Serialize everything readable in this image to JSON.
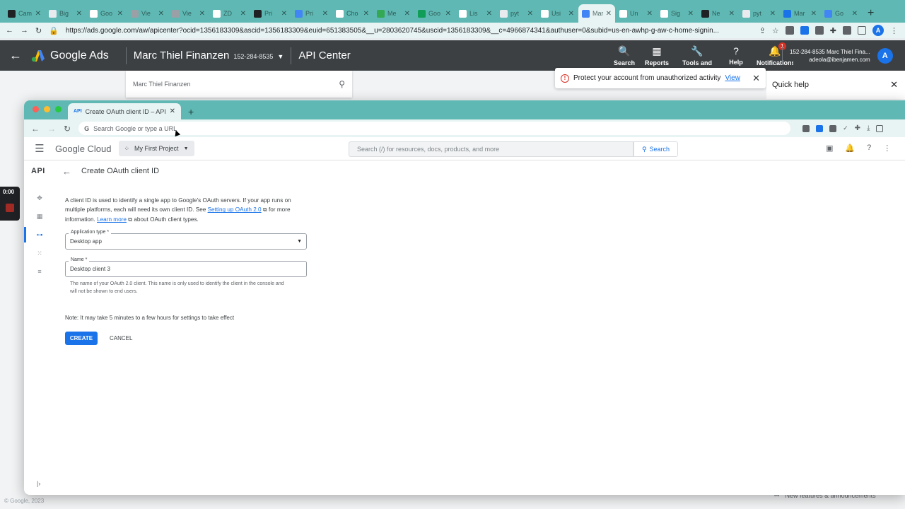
{
  "outer_tabs": [
    {
      "title": "Cam",
      "color": "#202124"
    },
    {
      "title": "Big",
      "color": "#e8eaed"
    },
    {
      "title": "Goo",
      "color": "#ffffff"
    },
    {
      "title": "Vie",
      "color": "#9aa0a6"
    },
    {
      "title": "Vie",
      "color": "#9aa0a6"
    },
    {
      "title": "ZD",
      "color": "#ffffff"
    },
    {
      "title": "Pri",
      "color": "#202124"
    },
    {
      "title": "Pri",
      "color": "#4285f4"
    },
    {
      "title": "Cho",
      "color": "#ffffff"
    },
    {
      "title": "Me",
      "color": "#34a853"
    },
    {
      "title": "Goo",
      "color": "#0f9d58"
    },
    {
      "title": "Lis",
      "color": "#ffffff"
    },
    {
      "title": "pyt",
      "color": "#e8eaed"
    },
    {
      "title": "Usi",
      "color": "#ffffff"
    },
    {
      "title": "Mar",
      "color": "#4285f4"
    },
    {
      "title": "Un",
      "color": "#ffffff"
    },
    {
      "title": "Sig",
      "color": "#ffffff"
    },
    {
      "title": "Ne",
      "color": "#202124"
    },
    {
      "title": "pyt",
      "color": "#e8eaed"
    },
    {
      "title": "Mar",
      "color": "#1a73e8"
    },
    {
      "title": "Go",
      "color": "#4285f4"
    }
  ],
  "outer_active_tab_index": 14,
  "outer_url": "https://ads.google.com/aw/apicenter?ocid=1356183309&ascid=1356183309&euid=651383505&__u=2803620745&uscid=1356183309&__c=4966874341&authuser=0&subid=us-en-awhp-g-aw-c-home-signin...",
  "outer_profile_initial": "A",
  "ads": {
    "product": "Google Ads",
    "account_name": "Marc Thiel Finanzen",
    "account_id": "152-284-8535",
    "page": "API Center",
    "tools": [
      {
        "label": "Search",
        "icon": "🔍"
      },
      {
        "label": "Reports",
        "icon": "▦"
      },
      {
        "label": "Tools and settings",
        "icon": "🔧"
      },
      {
        "label": "Help",
        "icon": "?"
      },
      {
        "label": "Notifications",
        "icon": "🔔"
      }
    ],
    "notification_count": "1",
    "user_line1": "152-284-8535 Marc Thiel Fina...",
    "user_line2": "adeola@ibenjamen.com",
    "user_initial": "A",
    "account_search_value": "Marc Thiel Finanzen",
    "alert_text": "Protect your account from unauthorized activity",
    "alert_link": "View",
    "quick_help": "Quick help",
    "copyright": "© Google, 2023",
    "footer_right": "New features & announcements"
  },
  "recorder_time": "0:00",
  "inner": {
    "tab_title": "Create OAuth client ID – APIs & Services",
    "address_placeholder": "Search Google or type a URL",
    "gc_logo": "Google Cloud",
    "project": "My First Project",
    "search_placeholder": "Search (/) for resources, docs, products, and more",
    "search_button": "Search",
    "api_label": "API",
    "page_title": "Create OAuth client ID",
    "desc_1": "A client ID is used to identify a single app to Google's OAuth servers. If your app runs on multiple platforms, each will need its own client ID. See ",
    "desc_link1": "Setting up OAuth 2.0",
    "desc_2": " for more information. ",
    "desc_link2": "Learn more",
    "desc_3": " about OAuth client types.",
    "app_type_label": "Application type *",
    "app_type_value": "Desktop app",
    "name_label": "Name *",
    "name_value": "Desktop client 3",
    "name_hint": "The name of your OAuth 2.0 client. This name is only used to identify the client in the console and will not be shown to end users.",
    "note": "Note: It may take 5 minutes to a few hours for settings to take effect",
    "create_label": "CREATE",
    "cancel_label": "CANCEL"
  }
}
